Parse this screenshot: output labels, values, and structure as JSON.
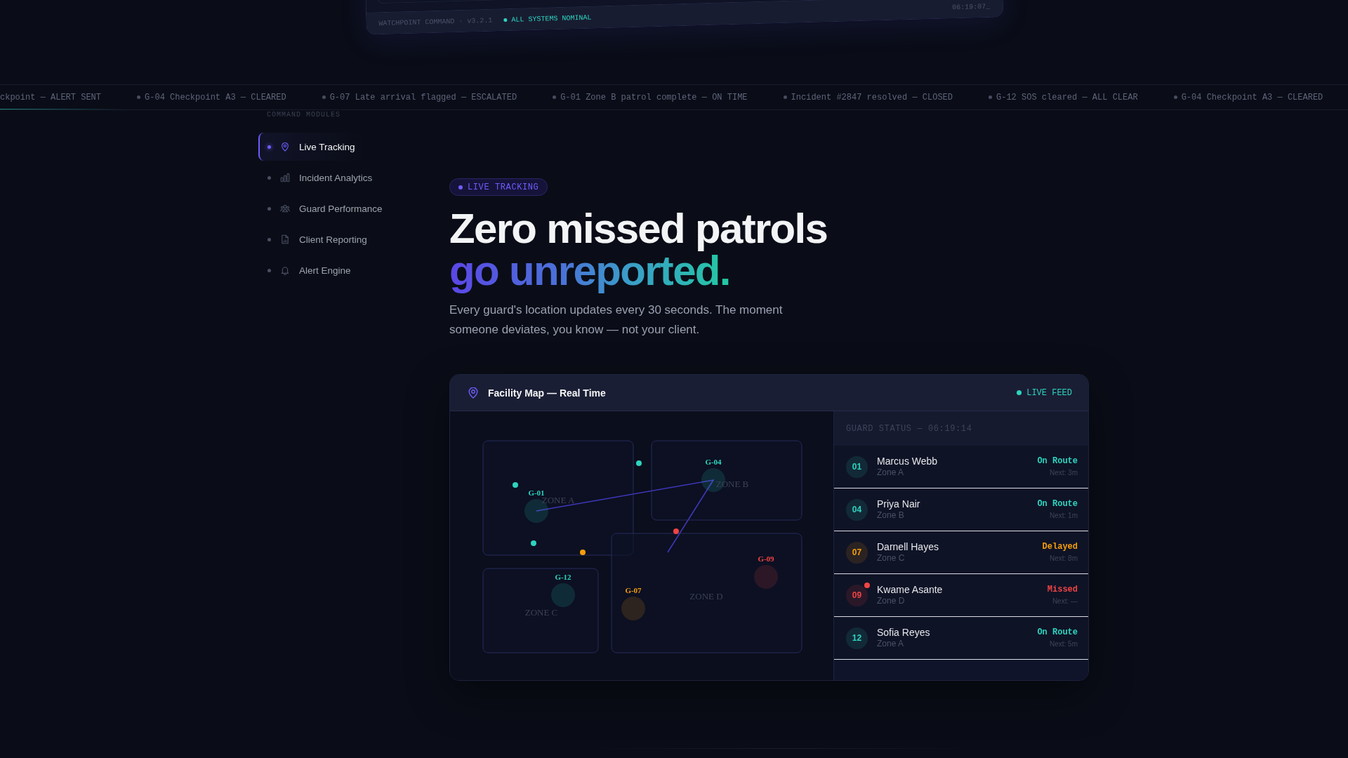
{
  "top_panel": {
    "product": "WATCHPOINT COMMAND · v3.2.1",
    "system_status": "ALL SYSTEMS NOMINAL",
    "clock": "06:19:07_"
  },
  "ticker": [
    {
      "text": "ckpoint — ALERT SENT",
      "bullet": false
    },
    {
      "text": "G-04 Checkpoint A3 — CLEARED",
      "bullet": true
    },
    {
      "text": "G-07 Late arrival flagged — ESCALATED",
      "bullet": true
    },
    {
      "text": "G-01 Zone B patrol complete — ON TIME",
      "bullet": true
    },
    {
      "text": "Incident #2847 resolved — CLOSED",
      "bullet": true
    },
    {
      "text": "G-12 SOS cleared — ALL CLEAR",
      "bullet": true
    },
    {
      "text": "G-04 Checkpoint A3 — CLEARED",
      "bullet": true
    }
  ],
  "sidebar": {
    "heading": "COMMAND MODULES",
    "items": [
      {
        "label": "Live Tracking",
        "selected": true
      },
      {
        "label": "Incident Analytics",
        "selected": false
      },
      {
        "label": "Guard Performance",
        "selected": false
      },
      {
        "label": "Client Reporting",
        "selected": false
      },
      {
        "label": "Alert Engine",
        "selected": false
      }
    ]
  },
  "hero": {
    "badge": "LIVE TRACKING",
    "headline": "Zero missed patrols",
    "headline_accent": "go unreported.",
    "description": "Every guard's location updates every 30 seconds. The moment someone deviates, you know — not your client."
  },
  "map_panel": {
    "title": "Facility Map — Real Time",
    "feed_status": "LIVE FEED",
    "map": {
      "zones": [
        {
          "label": "ZONE A"
        },
        {
          "label": "ZONE B"
        },
        {
          "label": "ZONE C"
        },
        {
          "label": "ZONE D"
        }
      ],
      "markers": [
        {
          "label": "G-04",
          "color": "#2dd4bf"
        },
        {
          "label": "G-01",
          "color": "#2dd4bf"
        },
        {
          "label": "G-09",
          "color": "#ef4444"
        },
        {
          "label": "G-12",
          "color": "#2dd4bf"
        },
        {
          "label": "G-07",
          "color": "#f59e0b"
        }
      ],
      "checkpoints": [
        {
          "color": "#2dd4bf"
        },
        {
          "color": "#2dd4bf"
        },
        {
          "color": "#ef4444"
        },
        {
          "color": "#2dd4bf"
        },
        {
          "color": "#f59e0b"
        }
      ]
    },
    "guard_status": {
      "heading": "GUARD STATUS — 06:19:14",
      "guards": [
        {
          "number": "01",
          "name": "Marcus Webb",
          "zone": "Zone A",
          "status": "On Route",
          "next": "Next: 3m",
          "color": "#2dd4bf",
          "alert": false
        },
        {
          "number": "04",
          "name": "Priya Nair",
          "zone": "Zone B",
          "status": "On Route",
          "next": "Next: 1m",
          "color": "#2dd4bf",
          "alert": false
        },
        {
          "number": "07",
          "name": "Darnell Hayes",
          "zone": "Zone C",
          "status": "Delayed",
          "next": "Next: 8m",
          "color": "#f59e0b",
          "alert": false
        },
        {
          "number": "09",
          "name": "Kwame Asante",
          "zone": "Zone D",
          "status": "Missed",
          "next": "Next: —",
          "color": "#ef4444",
          "alert": true
        },
        {
          "number": "12",
          "name": "Sofia Reyes",
          "zone": "Zone A",
          "status": "On Route",
          "next": "Next: 5m",
          "color": "#2dd4bf",
          "alert": false
        }
      ]
    }
  }
}
